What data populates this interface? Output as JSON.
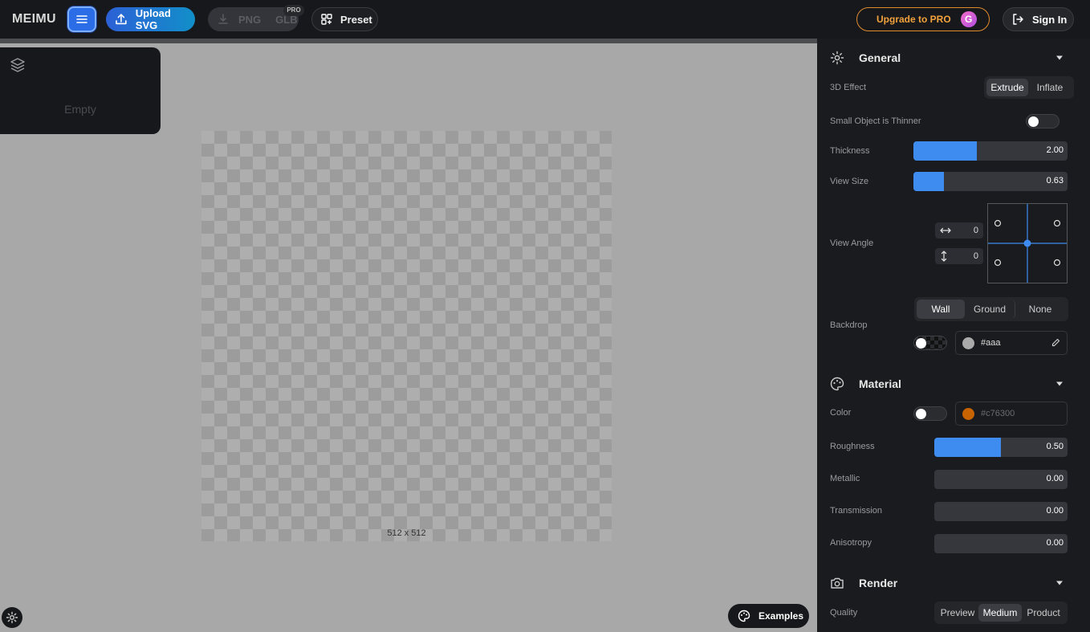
{
  "app": {
    "logo": "MEIMU"
  },
  "toolbar": {
    "upload_label": "Upload SVG",
    "png_label": "PNG",
    "glb_label": "GLB",
    "pro_badge": "PRO",
    "preset_label": "Preset",
    "upgrade_label": "Upgrade to PRO",
    "upgrade_icon_letter": "G",
    "signin_label": "Sign In"
  },
  "layers": {
    "empty_text": "Empty"
  },
  "canvas": {
    "size_label": "512 x 512"
  },
  "examples_label": "Examples",
  "general": {
    "title": "General",
    "effect_label": "3D Effect",
    "effect_options": [
      "Extrude",
      "Inflate"
    ],
    "effect_selected": "Extrude",
    "thinner_label": "Small Object is Thinner",
    "thinner_on": false,
    "thickness_label": "Thickness",
    "thickness_value": "2.00",
    "thickness_fill": 0.41,
    "viewsize_label": "View Size",
    "viewsize_value": "0.63",
    "viewsize_fill": 0.2,
    "viewangle_label": "View Angle",
    "angle_h": "0",
    "angle_v": "0",
    "backdrop_label": "Backdrop",
    "backdrop_options": [
      "Wall",
      "Ground",
      "None"
    ],
    "backdrop_selected": "Wall",
    "backdrop_color": "#aaa",
    "backdrop_enabled": false
  },
  "material": {
    "title": "Material",
    "color_label": "Color",
    "color_value": "#c76300",
    "color_enabled": false,
    "roughness_label": "Roughness",
    "roughness_value": "0.50",
    "roughness_fill": 0.5,
    "metallic_label": "Metallic",
    "metallic_value": "0.00",
    "transmission_label": "Transmission",
    "transmission_value": "0.00",
    "anisotropy_label": "Anisotropy",
    "anisotropy_value": "0.00"
  },
  "render": {
    "title": "Render",
    "quality_label": "Quality",
    "quality_options": [
      "Preview",
      "Medium",
      "Product"
    ],
    "quality_selected": "Medium"
  },
  "colors": {
    "accent": "#3e8cf0",
    "upgrade": "#f2a23c",
    "panel": "#1a1b1e",
    "topbar": "#17181b"
  }
}
